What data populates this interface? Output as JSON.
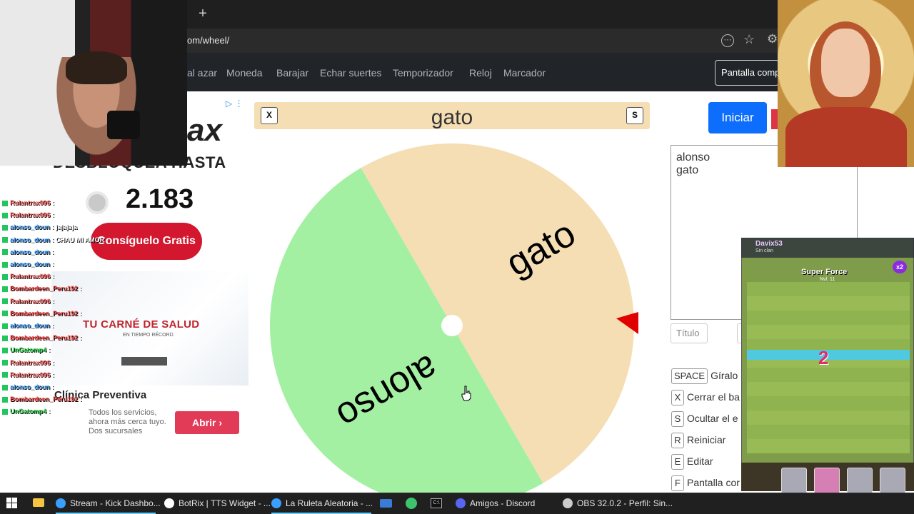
{
  "browser": {
    "new_tab_label": "+",
    "url": "om/wheel/"
  },
  "site_nav": {
    "items": [
      "al azar",
      "Moneda",
      "Barajar",
      "Echar suertes",
      "Temporizador",
      "Reloj",
      "Marcador"
    ],
    "fullscreen_label": "Pantalla comp"
  },
  "wheel": {
    "result": "gato",
    "close_key": "X",
    "hide_key": "S",
    "segments": [
      {
        "label": "gato",
        "color": "#f5deb3"
      },
      {
        "label": "alonso",
        "color": "#a3f0a3"
      }
    ]
  },
  "controls": {
    "start_label": "Iniciar",
    "entries_text": "alonso\ngato",
    "title_placeholder": "Título",
    "shortcuts": [
      {
        "key": "SPACE",
        "label": "Gíralo"
      },
      {
        "key": "X",
        "label": "Cerrar el ba"
      },
      {
        "key": "S",
        "label": "Ocultar el e"
      },
      {
        "key": "R",
        "label": "Reiniciar"
      },
      {
        "key": "E",
        "label": "Editar"
      },
      {
        "key": "F",
        "label": "Pantalla cor"
      }
    ]
  },
  "ad": {
    "logo": "ax",
    "headline": "DESBLOQUEA HASTA",
    "number": "2.183",
    "cta": "Consíguelo Gratis",
    "ad2_title": "TU CARNÉ DE SALUD",
    "ad2_sub": "EN TIEMPO RÉCORD",
    "clinic_name": "Clínica Preventiva",
    "clinic_desc": "Todos los servicios, ahora más cerca tuyo. Dos sucursales",
    "open_label": "Abrir ›"
  },
  "chat": [
    {
      "user": "Rulantrax096",
      "msg": ":",
      "color": "#ff6b6b"
    },
    {
      "user": "Rulantrax096",
      "msg": ":",
      "color": "#ff6b6b"
    },
    {
      "user": "alonso_doun",
      "msg": ": jajajaja",
      "color": "#4da6ff"
    },
    {
      "user": "alonso_doun",
      "msg": ": CHAU MI AMOR",
      "color": "#4da6ff"
    },
    {
      "user": "alonso_doun",
      "msg": ":",
      "color": "#4da6ff"
    },
    {
      "user": "alonso_doun",
      "msg": ":",
      "color": "#4da6ff"
    },
    {
      "user": "Rulantrax096",
      "msg": ":",
      "color": "#ff6b6b"
    },
    {
      "user": "Bombardeen_Peru192",
      "msg": ":",
      "color": "#ff4d4d"
    },
    {
      "user": "Rulantrax096",
      "msg": ":",
      "color": "#ff6b6b"
    },
    {
      "user": "Bombardeen_Peru192",
      "msg": ":",
      "color": "#ff4d4d"
    },
    {
      "user": "alonso_doun",
      "msg": ":",
      "color": "#4da6ff"
    },
    {
      "user": "Bombardeen_Peru192",
      "msg": ":",
      "color": "#ff4d4d"
    },
    {
      "user": "UnGatomp4",
      "msg": ":",
      "color": "#33dd55"
    },
    {
      "user": "Rulantrax096",
      "msg": ":",
      "color": "#ff6b6b"
    },
    {
      "user": "Rulantrax096",
      "msg": ":",
      "color": "#ff6b6b"
    },
    {
      "user": "alonso_doun",
      "msg": ":",
      "color": "#4da6ff"
    },
    {
      "user": "Bombardeen_Peru192",
      "msg": ":",
      "color": "#ff4d4d"
    },
    {
      "user": "UnGatomp4",
      "msg": ":",
      "color": "#33dd55"
    }
  ],
  "game": {
    "player": "Davix53",
    "clan": "Sin clan",
    "banner": "Super Force",
    "banner_sub": "Nvl. 11",
    "score": "2",
    "multiplier": "x2"
  },
  "taskbar": {
    "items": [
      {
        "label": "Stream - Kick Dashbo...",
        "color": "#3aa0ff"
      },
      {
        "label": "BotRix | TTS Widget - ...",
        "color": "#ffffff"
      },
      {
        "label": "La Ruleta Aleatoria - ...",
        "color": "#3aa0ff"
      },
      {
        "label": "Amigos - Discord",
        "color": "#5865f2"
      },
      {
        "label": "OBS 32.0.2 - Perfil: Sin...",
        "color": "#cccccc"
      }
    ]
  },
  "colors": {
    "start_button": "#0d6efd",
    "result_bar": "#f5deb3",
    "pointer": "#e00000"
  }
}
